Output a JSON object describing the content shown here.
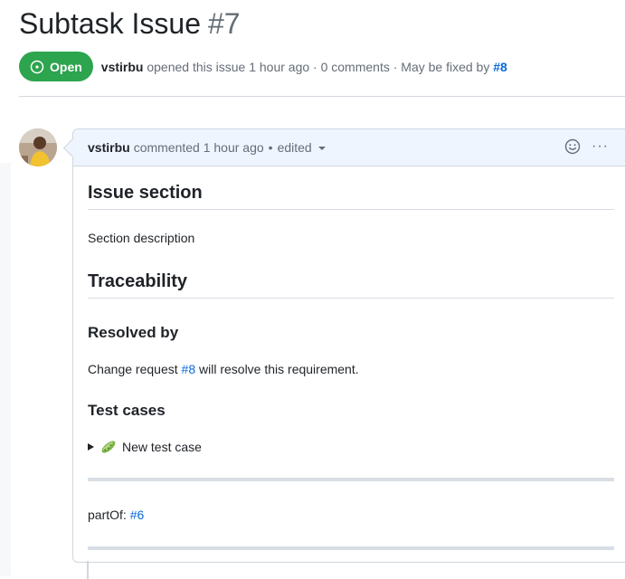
{
  "issue": {
    "title": "Subtask Issue",
    "number": "#7",
    "state": "Open",
    "author": "vstirbu",
    "meta_opened": "opened this issue 1 hour ago · 0 comments · May be fixed by",
    "fixed_by": "#8"
  },
  "comment": {
    "author": "vstirbu",
    "meta": "commented 1 hour ago",
    "separator": "•",
    "edited": "edited",
    "more_menu": "···",
    "body": {
      "h_issue_section": "Issue section",
      "section_description": "Section description",
      "h_traceability": "Traceability",
      "h_resolved_by": "Resolved by",
      "resolved_prefix": "Change request",
      "resolved_link": "#8",
      "resolved_suffix": "will resolve this requirement.",
      "h_test_cases": "Test cases",
      "test_case_summary": "New test case",
      "part_of_label": "partOf:",
      "part_of_link": "#6"
    }
  },
  "icons": {
    "state": "issue-opened-icon",
    "reaction": "smiley-icon",
    "more": "kebab-horizontal-icon",
    "disclosure": "triangle-right-icon",
    "test_case": "cucumber-icon"
  },
  "colors": {
    "open_green": "#2da44e",
    "link_blue": "#0969da",
    "header_bg": "#eef5ff"
  }
}
